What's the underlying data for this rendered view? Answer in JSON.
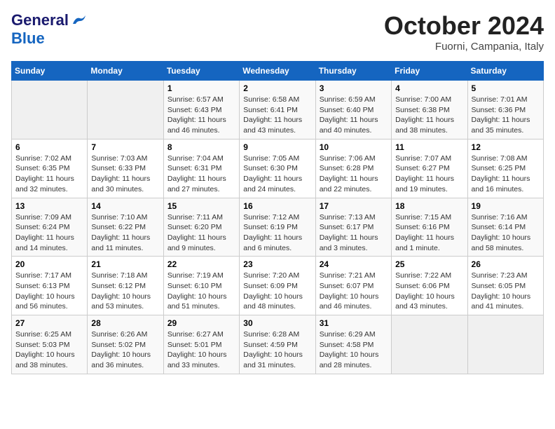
{
  "header": {
    "logo_line1": "General",
    "logo_line2": "Blue",
    "month": "October 2024",
    "location": "Fuorni, Campania, Italy"
  },
  "weekdays": [
    "Sunday",
    "Monday",
    "Tuesday",
    "Wednesday",
    "Thursday",
    "Friday",
    "Saturday"
  ],
  "weeks": [
    [
      {
        "day": "",
        "detail": ""
      },
      {
        "day": "",
        "detail": ""
      },
      {
        "day": "1",
        "detail": "Sunrise: 6:57 AM\nSunset: 6:43 PM\nDaylight: 11 hours and 46 minutes."
      },
      {
        "day": "2",
        "detail": "Sunrise: 6:58 AM\nSunset: 6:41 PM\nDaylight: 11 hours and 43 minutes."
      },
      {
        "day": "3",
        "detail": "Sunrise: 6:59 AM\nSunset: 6:40 PM\nDaylight: 11 hours and 40 minutes."
      },
      {
        "day": "4",
        "detail": "Sunrise: 7:00 AM\nSunset: 6:38 PM\nDaylight: 11 hours and 38 minutes."
      },
      {
        "day": "5",
        "detail": "Sunrise: 7:01 AM\nSunset: 6:36 PM\nDaylight: 11 hours and 35 minutes."
      }
    ],
    [
      {
        "day": "6",
        "detail": "Sunrise: 7:02 AM\nSunset: 6:35 PM\nDaylight: 11 hours and 32 minutes."
      },
      {
        "day": "7",
        "detail": "Sunrise: 7:03 AM\nSunset: 6:33 PM\nDaylight: 11 hours and 30 minutes."
      },
      {
        "day": "8",
        "detail": "Sunrise: 7:04 AM\nSunset: 6:31 PM\nDaylight: 11 hours and 27 minutes."
      },
      {
        "day": "9",
        "detail": "Sunrise: 7:05 AM\nSunset: 6:30 PM\nDaylight: 11 hours and 24 minutes."
      },
      {
        "day": "10",
        "detail": "Sunrise: 7:06 AM\nSunset: 6:28 PM\nDaylight: 11 hours and 22 minutes."
      },
      {
        "day": "11",
        "detail": "Sunrise: 7:07 AM\nSunset: 6:27 PM\nDaylight: 11 hours and 19 minutes."
      },
      {
        "day": "12",
        "detail": "Sunrise: 7:08 AM\nSunset: 6:25 PM\nDaylight: 11 hours and 16 minutes."
      }
    ],
    [
      {
        "day": "13",
        "detail": "Sunrise: 7:09 AM\nSunset: 6:24 PM\nDaylight: 11 hours and 14 minutes."
      },
      {
        "day": "14",
        "detail": "Sunrise: 7:10 AM\nSunset: 6:22 PM\nDaylight: 11 hours and 11 minutes."
      },
      {
        "day": "15",
        "detail": "Sunrise: 7:11 AM\nSunset: 6:20 PM\nDaylight: 11 hours and 9 minutes."
      },
      {
        "day": "16",
        "detail": "Sunrise: 7:12 AM\nSunset: 6:19 PM\nDaylight: 11 hours and 6 minutes."
      },
      {
        "day": "17",
        "detail": "Sunrise: 7:13 AM\nSunset: 6:17 PM\nDaylight: 11 hours and 3 minutes."
      },
      {
        "day": "18",
        "detail": "Sunrise: 7:15 AM\nSunset: 6:16 PM\nDaylight: 11 hours and 1 minute."
      },
      {
        "day": "19",
        "detail": "Sunrise: 7:16 AM\nSunset: 6:14 PM\nDaylight: 10 hours and 58 minutes."
      }
    ],
    [
      {
        "day": "20",
        "detail": "Sunrise: 7:17 AM\nSunset: 6:13 PM\nDaylight: 10 hours and 56 minutes."
      },
      {
        "day": "21",
        "detail": "Sunrise: 7:18 AM\nSunset: 6:12 PM\nDaylight: 10 hours and 53 minutes."
      },
      {
        "day": "22",
        "detail": "Sunrise: 7:19 AM\nSunset: 6:10 PM\nDaylight: 10 hours and 51 minutes."
      },
      {
        "day": "23",
        "detail": "Sunrise: 7:20 AM\nSunset: 6:09 PM\nDaylight: 10 hours and 48 minutes."
      },
      {
        "day": "24",
        "detail": "Sunrise: 7:21 AM\nSunset: 6:07 PM\nDaylight: 10 hours and 46 minutes."
      },
      {
        "day": "25",
        "detail": "Sunrise: 7:22 AM\nSunset: 6:06 PM\nDaylight: 10 hours and 43 minutes."
      },
      {
        "day": "26",
        "detail": "Sunrise: 7:23 AM\nSunset: 6:05 PM\nDaylight: 10 hours and 41 minutes."
      }
    ],
    [
      {
        "day": "27",
        "detail": "Sunrise: 6:25 AM\nSunset: 5:03 PM\nDaylight: 10 hours and 38 minutes."
      },
      {
        "day": "28",
        "detail": "Sunrise: 6:26 AM\nSunset: 5:02 PM\nDaylight: 10 hours and 36 minutes."
      },
      {
        "day": "29",
        "detail": "Sunrise: 6:27 AM\nSunset: 5:01 PM\nDaylight: 10 hours and 33 minutes."
      },
      {
        "day": "30",
        "detail": "Sunrise: 6:28 AM\nSunset: 4:59 PM\nDaylight: 10 hours and 31 minutes."
      },
      {
        "day": "31",
        "detail": "Sunrise: 6:29 AM\nSunset: 4:58 PM\nDaylight: 10 hours and 28 minutes."
      },
      {
        "day": "",
        "detail": ""
      },
      {
        "day": "",
        "detail": ""
      }
    ]
  ]
}
